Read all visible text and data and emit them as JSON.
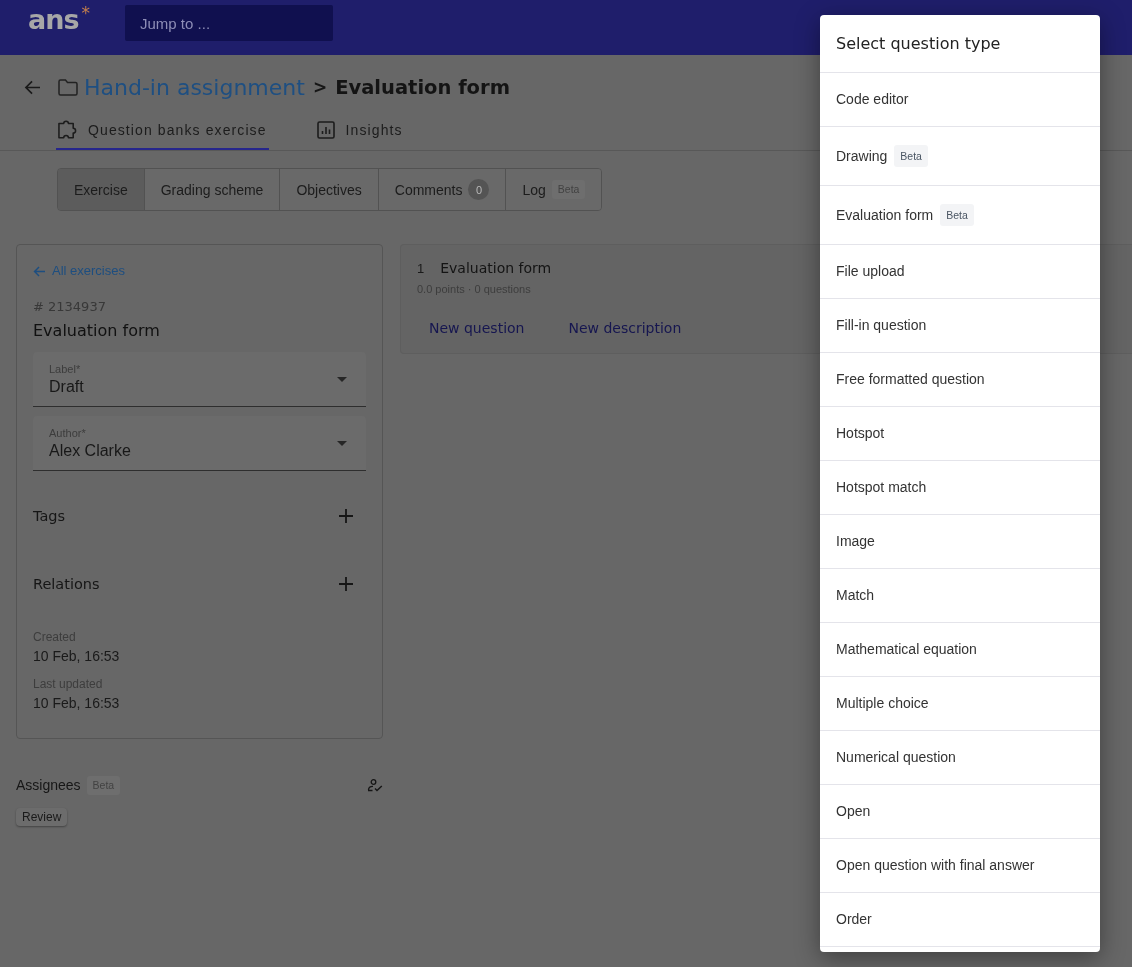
{
  "header": {
    "logo": "ans$^{*}$",
    "search": {
      "placeholder": "Jump to ..."
    }
  },
  "breadcrumb": {
    "parent": "Hand-in assignment",
    "separator": ">",
    "current": "Evaluation form"
  },
  "page_tabs": [
    {
      "label": "Question banks exercise",
      "selected": true
    },
    {
      "label": "Insights",
      "selected": false
    }
  ],
  "sub_tabs": [
    {
      "label": "Exercise",
      "selected": true
    },
    {
      "label": "Grading scheme",
      "selected": false
    },
    {
      "label": "Objectives",
      "selected": false
    },
    {
      "label": "Comments",
      "count": "0",
      "selected": false
    },
    {
      "label": "Log",
      "badge": "Beta",
      "selected": false
    }
  ],
  "exercise_panel": {
    "back_link": "All exercises",
    "id": "# 2134937",
    "title": "Evaluation form",
    "fields": [
      {
        "label": "Label*",
        "value": "Draft"
      },
      {
        "label": "Author*",
        "value": "Alex Clarke"
      }
    ],
    "sections": [
      "Tags",
      "Relations"
    ],
    "meta": [
      {
        "label": "Created",
        "value": "10 Feb, 16:53"
      },
      {
        "label": "Last updated",
        "value": "10 Feb, 16:53"
      }
    ]
  },
  "assignees": {
    "title": "Assignees",
    "badge": "Beta",
    "chips": [
      "Review"
    ]
  },
  "question_group": {
    "number": "1",
    "title": "Evaluation form",
    "summary": "0.0 points · 0 questions",
    "actions": [
      "New question",
      "New description"
    ]
  },
  "question_type_menu": {
    "title": "Select question type",
    "items": [
      {
        "label": "Code editor"
      },
      {
        "label": "Drawing",
        "badge": "Beta"
      },
      {
        "label": "Evaluation form",
        "badge": "Beta"
      },
      {
        "label": "File upload"
      },
      {
        "label": "Fill-in question"
      },
      {
        "label": "Free formatted question"
      },
      {
        "label": "Hotspot"
      },
      {
        "label": "Hotspot match"
      },
      {
        "label": "Image"
      },
      {
        "label": "Match"
      },
      {
        "label": "Mathematical equation"
      },
      {
        "label": "Multiple choice"
      },
      {
        "label": "Numerical question"
      },
      {
        "label": "Open"
      },
      {
        "label": "Open question with final answer"
      },
      {
        "label": "Order"
      }
    ]
  }
}
